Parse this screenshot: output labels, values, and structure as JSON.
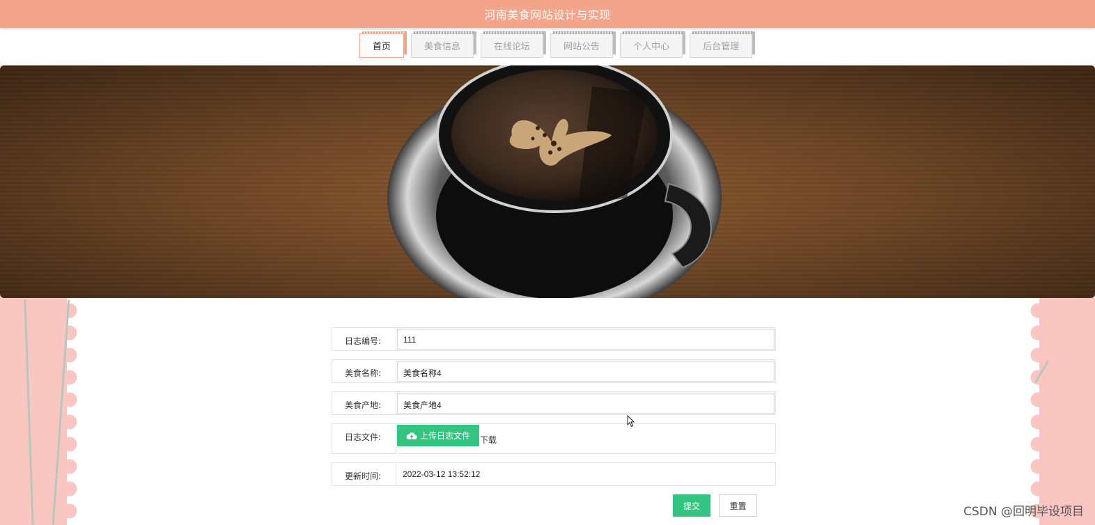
{
  "header": {
    "title": "河南美食网站设计与实现"
  },
  "nav": {
    "items": [
      {
        "label": "首页",
        "active": true
      },
      {
        "label": "美食信息",
        "active": false
      },
      {
        "label": "在线论坛",
        "active": false
      },
      {
        "label": "网站公告",
        "active": false
      },
      {
        "label": "个人中心",
        "active": false
      },
      {
        "label": "后台管理",
        "active": false
      }
    ]
  },
  "banner": {
    "image": "coffee-cup-with-butterfly-latte-art"
  },
  "form": {
    "log_number": {
      "label": "日志编号:",
      "value": "111"
    },
    "food_name": {
      "label": "美食名称:",
      "value": "美食名称4"
    },
    "food_origin": {
      "label": "美食产地:",
      "value": "美食产地4"
    },
    "log_file": {
      "label": "日志文件:",
      "upload_label": "上传日志文件",
      "download_label": "下载"
    },
    "update_time": {
      "label": "更新时间:",
      "value": "2022-03-12 13:52:12"
    },
    "submit_label": "提交",
    "reset_label": "重置"
  },
  "watermark": "CSDN @回明毕设项目",
  "colors": {
    "header": "#f4a48a",
    "accent_green": "#33c482",
    "side_pink": "#fac6c2"
  }
}
